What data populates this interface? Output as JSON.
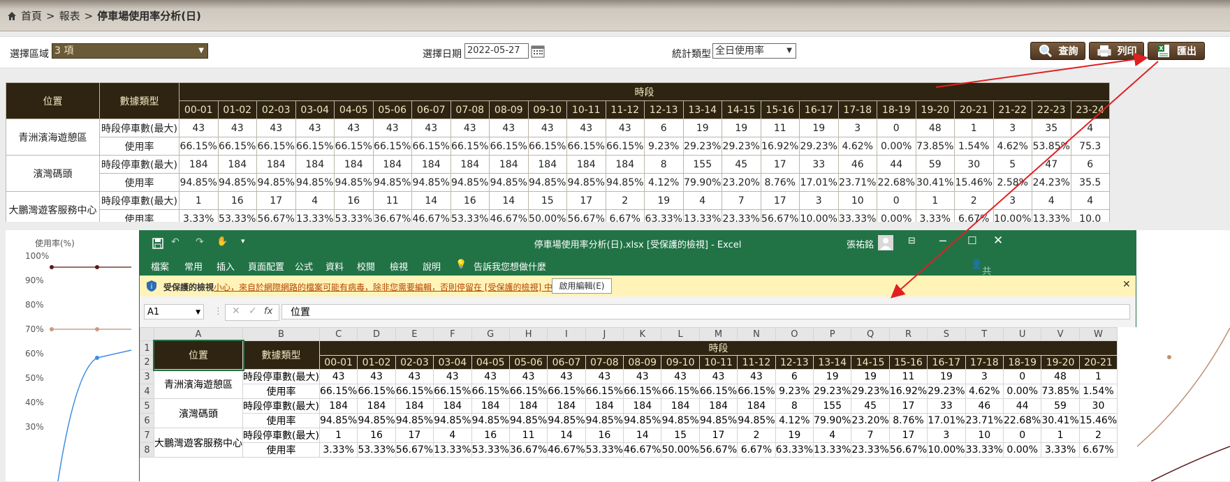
{
  "breadcrumb": {
    "home": "首頁",
    "sep1": ">",
    "reports": "報表",
    "sep2": ">",
    "current": "停車場使用率分析(日)"
  },
  "filters": {
    "area_label": "選擇區域",
    "area_value": "3 項",
    "date_label": "選擇日期",
    "date_value": "2022-05-27",
    "type_label": "統計類型",
    "type_value": "全日使用率"
  },
  "buttons": {
    "query": "查詢",
    "print": "列印",
    "export": "匯出"
  },
  "report": {
    "col_location": "位置",
    "col_datatype": "數據類型",
    "col_period": "時段",
    "hours": [
      "00-01",
      "01-02",
      "02-03",
      "03-04",
      "04-05",
      "05-06",
      "06-07",
      "07-08",
      "08-09",
      "09-10",
      "10-11",
      "11-12",
      "12-13",
      "13-14",
      "14-15",
      "15-16",
      "16-17",
      "17-18",
      "18-19",
      "19-20",
      "20-21",
      "21-22",
      "22-23",
      "23-24"
    ],
    "rows": [
      {
        "location": "青洲濱海遊憩區",
        "count_label": "時段停車數(最大)",
        "counts": [
          "43",
          "43",
          "43",
          "43",
          "43",
          "43",
          "43",
          "43",
          "43",
          "43",
          "43",
          "43",
          "6",
          "19",
          "19",
          "11",
          "19",
          "3",
          "0",
          "48",
          "1",
          "3",
          "35",
          "4"
        ],
        "rate_label": "使用率",
        "rates": [
          "66.15%",
          "66.15%",
          "66.15%",
          "66.15%",
          "66.15%",
          "66.15%",
          "66.15%",
          "66.15%",
          "66.15%",
          "66.15%",
          "66.15%",
          "66.15%",
          "9.23%",
          "29.23%",
          "29.23%",
          "16.92%",
          "29.23%",
          "4.62%",
          "0.00%",
          "73.85%",
          "1.54%",
          "4.62%",
          "53.85%",
          "75.3"
        ]
      },
      {
        "location": "濱灣碼頭",
        "count_label": "時段停車數(最大)",
        "counts": [
          "184",
          "184",
          "184",
          "184",
          "184",
          "184",
          "184",
          "184",
          "184",
          "184",
          "184",
          "184",
          "8",
          "155",
          "45",
          "17",
          "33",
          "46",
          "44",
          "59",
          "30",
          "5",
          "47",
          "6"
        ],
        "rate_label": "使用率",
        "rates": [
          "94.85%",
          "94.85%",
          "94.85%",
          "94.85%",
          "94.85%",
          "94.85%",
          "94.85%",
          "94.85%",
          "94.85%",
          "94.85%",
          "94.85%",
          "94.85%",
          "4.12%",
          "79.90%",
          "23.20%",
          "8.76%",
          "17.01%",
          "23.71%",
          "22.68%",
          "30.41%",
          "15.46%",
          "2.58%",
          "24.23%",
          "35.5"
        ]
      },
      {
        "location": "大鵬灣遊客服務中心",
        "count_label": "時段停車數(最大)",
        "counts": [
          "1",
          "16",
          "17",
          "4",
          "16",
          "11",
          "14",
          "16",
          "14",
          "15",
          "17",
          "2",
          "19",
          "4",
          "7",
          "17",
          "3",
          "10",
          "0",
          "1",
          "2",
          "3",
          "4",
          "4"
        ],
        "rate_label": "使用率",
        "rates": [
          "3.33%",
          "53.33%",
          "56.67%",
          "13.33%",
          "53.33%",
          "36.67%",
          "46.67%",
          "53.33%",
          "46.67%",
          "50.00%",
          "56.67%",
          "6.67%",
          "63.33%",
          "13.33%",
          "23.33%",
          "56.67%",
          "10.00%",
          "33.33%",
          "0.00%",
          "3.33%",
          "6.67%",
          "10.00%",
          "13.33%",
          "10.0"
        ]
      }
    ]
  },
  "chart": {
    "ylabel": "使用率(%)",
    "yticks": [
      "100%",
      "90%",
      "80%",
      "70%",
      "60%",
      "50%",
      "40%",
      "30%"
    ]
  },
  "excel": {
    "title": "停車場使用率分析(日).xlsx [受保護的檢視] - Excel",
    "user": "張祐銘",
    "menu": [
      "檔案",
      "常用",
      "插入",
      "頁面配置",
      "公式",
      "資料",
      "校閱",
      "檢視",
      "說明"
    ],
    "tell_me": "告訴我您想做什麼",
    "share": "共用",
    "warn_title": "受保護的檢視",
    "warn_text": "小心，來自於網際網路的檔案可能有病毒，除非您需要編輯，否則停留在 [受保護的檢視] 中較為安全。",
    "enable_btn": "啟用編輯(E)",
    "name_box": "A1",
    "fx": "fx",
    "formula": "位置",
    "col_letters": [
      "A",
      "B",
      "C",
      "D",
      "E",
      "F",
      "G",
      "H",
      "I",
      "J",
      "K",
      "L",
      "M",
      "N",
      "O",
      "P",
      "Q",
      "R",
      "S",
      "T",
      "U",
      "V",
      "W"
    ],
    "row_numbers": [
      "1",
      "2",
      "3",
      "4",
      "5",
      "6",
      "7",
      "8"
    ]
  },
  "colors": {
    "header_bg": "#2e2411",
    "header_fg": "#f1e7c4",
    "excel_green": "#217346",
    "warn_bg": "#fff3b8",
    "arrow": "#e02020"
  }
}
